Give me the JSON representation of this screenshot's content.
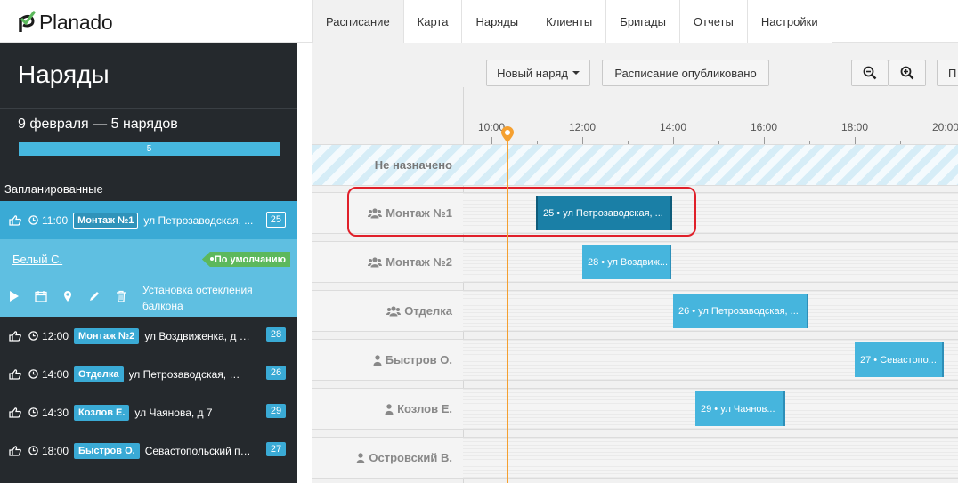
{
  "app": {
    "logo_text": "Planado",
    "brand_color": "#5cb85c",
    "accent_color": "#46b5dd"
  },
  "nav": {
    "tabs": [
      {
        "label": "Расписание"
      },
      {
        "label": "Карта"
      },
      {
        "label": "Наряды"
      },
      {
        "label": "Клиенты"
      },
      {
        "label": "Бригады"
      },
      {
        "label": "Отчеты"
      },
      {
        "label": "Настройки"
      }
    ],
    "active": "Расписание"
  },
  "sidebar": {
    "title": "Наряды",
    "date_summary": "9 февраля — 5 нарядов",
    "progress_value": "5",
    "group_label": "Запланированные",
    "orders": [
      {
        "time": "11:00",
        "tag": "Монтаж №1",
        "address": "ул Петрозаводская, ...",
        "number": "25"
      },
      {
        "time": "12:00",
        "tag": "Монтаж №2",
        "address": "ул Воздвиженка, д 3 ...",
        "number": "28"
      },
      {
        "time": "14:00",
        "tag": "Отделка",
        "address": "ул Петрозаводская, д 2/...",
        "number": "26"
      },
      {
        "time": "14:30",
        "tag": "Козлов Е.",
        "address": "ул Чаянова, д 7",
        "number": "29"
      },
      {
        "time": "18:00",
        "tag": "Быстров О.",
        "address": "Севастопольский пр-...",
        "number": "27"
      }
    ],
    "expanded": {
      "assignee": "Белый С.",
      "badge": "По умолчанию",
      "description": "Установка остекления балкона"
    }
  },
  "toolbar": {
    "new_order": "Новый наряд",
    "published": "Расписание опубликовано",
    "zoom_out": "zoom-out-icon",
    "zoom_in": "zoom-in-icon",
    "next_partial": "П"
  },
  "timeline": {
    "ticks": [
      "10:00",
      "12:00",
      "14:00",
      "16:00",
      "18:00",
      "20:00"
    ],
    "rows": [
      {
        "label": "Не назначено",
        "icon": "",
        "tasks": []
      },
      {
        "label": "Монтаж №1",
        "icon": "group-icon",
        "tasks": [
          {
            "text": "25 • ул Петрозаводская, ..."
          }
        ]
      },
      {
        "label": "Монтаж №2",
        "icon": "group-icon",
        "tasks": [
          {
            "text": "28 • ул Воздвиж..."
          }
        ]
      },
      {
        "label": "Отделка",
        "icon": "group-icon",
        "tasks": [
          {
            "text": "26 • ул Петрозаводская, ..."
          }
        ]
      },
      {
        "label": "Быстров О.",
        "icon": "user-icon",
        "tasks": [
          {
            "text": "27 • Севастопо..."
          }
        ]
      },
      {
        "label": "Козлов Е.",
        "icon": "user-icon",
        "tasks": [
          {
            "text": "29 • ул Чаянов..."
          }
        ]
      },
      {
        "label": "Островский В.",
        "icon": "user-icon",
        "tasks": []
      }
    ]
  }
}
